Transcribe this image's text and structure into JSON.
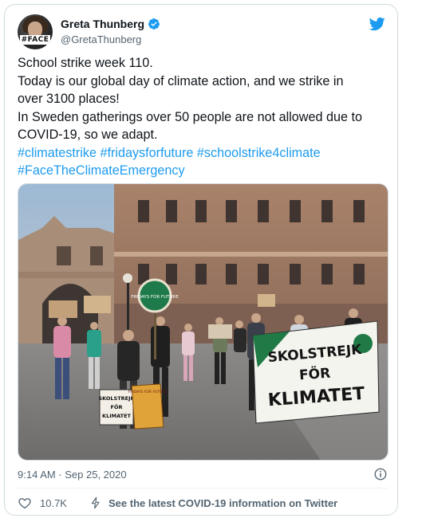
{
  "author": {
    "name": "Greta Thunberg",
    "handle": "@GretaThunberg",
    "avatar_tag": "#FACE"
  },
  "tweet": {
    "lines": [
      "School strike week 110.",
      "Today is our global day of climate action, and we strike in",
      "over 3100 places!",
      "In Sweden gatherings over 50 people are not allowed due to",
      "COVID-19, so we adapt."
    ],
    "hashtags": [
      "#climatestrike",
      "#fridaysforfuture",
      "#schoolstrike4climate",
      "#FaceTheClimateEmergency"
    ]
  },
  "photo": {
    "banner_line1": "SKOLSTREJK",
    "banner_line2": "FÖR",
    "banner_line3": "KLIMATET",
    "sign_left_line1": "SKOLSTREJK",
    "sign_left_line2": "FÖR",
    "sign_left_line3": "KLIMATET",
    "sign_orange": "FRIDAYS FOR FUTURE",
    "round_sign": "FRIDAYS FOR FUTURE"
  },
  "timestamp": "9:14 AM · Sep 25, 2020",
  "footer": {
    "likes": "10.7K",
    "covid_link": "See the latest COVID-19 information on Twitter"
  },
  "colors": {
    "accent": "#1d9bf0",
    "text": "#0f1419",
    "secondary": "#536471",
    "border": "#cfd9de"
  },
  "icons": [
    "verified-badge-icon",
    "twitter-bird-icon",
    "info-icon",
    "heart-icon",
    "lightning-bolt-icon"
  ]
}
